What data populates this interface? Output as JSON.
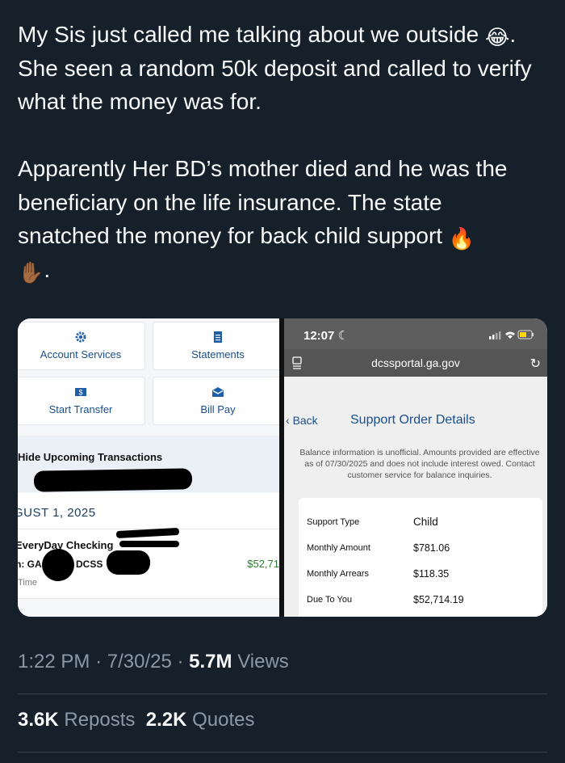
{
  "tweet": {
    "line1": "My Sis just called me talking about we outside",
    "emoji1": "😂",
    "line2": ". She seen a random 50k deposit and called to verify what the money was for.",
    "para2": "Apparently Her BD’s mother died and he was the beneficiary on the life insurance. The state snatched the money for back child support ",
    "emoji2": "🔥",
    "emoji3": "✋🏾",
    "end": "."
  },
  "bank_app": {
    "tiles": [
      {
        "label": "Account Services",
        "icon": "gear-icon"
      },
      {
        "label": "Statements",
        "icon": "document-icon"
      },
      {
        "label": "Start Transfer",
        "icon": "dollar-bill-icon"
      },
      {
        "label": "Bill Pay",
        "icon": "envelope-icon"
      }
    ],
    "hide_upcoming": "Hide Upcoming Transactions",
    "date_header": "GUST 1, 2025",
    "transaction": {
      "account": "EveryDay Checking",
      "desc_prefix": "n: GA",
      "desc_mid": "DCSS",
      "amount": "$52,71",
      "time": "Time"
    }
  },
  "portal": {
    "time": "12:07",
    "url": "dcssportal.ga.gov",
    "back": "Back",
    "title": "Support Order Details",
    "notice": "Balance information is unofficial. Amounts provided are effective as of 07/30/2025 and does not include interest owed. Contact customer service for balance inquiries.",
    "rows": [
      {
        "label": "Support Type",
        "value": "Child"
      },
      {
        "label": "Monthly Amount",
        "value": "$781.06"
      },
      {
        "label": "Monthly Arrears",
        "value": "$118.35"
      },
      {
        "label": "Due To You",
        "value": "$52,714.19"
      }
    ]
  },
  "meta": {
    "time": "1:22 PM",
    "dot": "·",
    "date": "7/30/25",
    "views_count": "5.7M",
    "views_label": "Views"
  },
  "stats": {
    "reposts_count": "3.6K",
    "reposts_label": "Reposts",
    "quotes_count": "2.2K",
    "quotes_label": "Quotes"
  }
}
